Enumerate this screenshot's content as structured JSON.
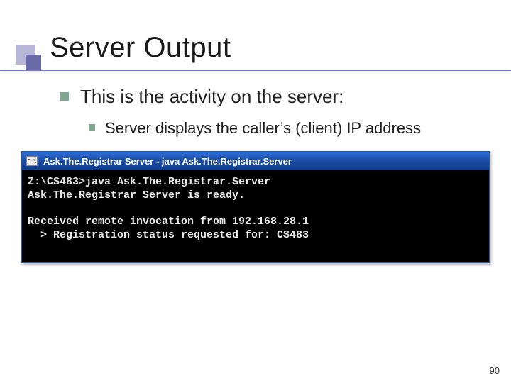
{
  "title": "Server Output",
  "bullets": {
    "main": "This is the activity on the server:",
    "sub": "Server displays the caller’s (client) IP address"
  },
  "terminal": {
    "icon_label": "C:\\",
    "window_title": "Ask.The.Registrar Server - java Ask.The.Registrar.Server",
    "lines": {
      "l0": "Z:\\CS483>java Ask.The.Registrar.Server",
      "l1": "Ask.The.Registrar Server is ready.",
      "l2": "",
      "l3": "Received remote invocation from 192.168.28.1",
      "l4": "  > Registration status requested for: CS483"
    }
  },
  "page_number": "90"
}
